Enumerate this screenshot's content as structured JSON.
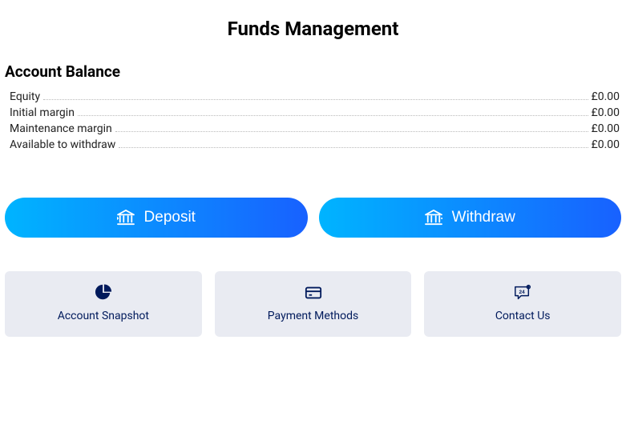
{
  "page_title": "Funds Management",
  "balance": {
    "section_title": "Account Balance",
    "rows": [
      {
        "label": "Equity",
        "value": "£0.00"
      },
      {
        "label": "Initial margin",
        "value": "£0.00"
      },
      {
        "label": "Maintenance margin",
        "value": "£0.00"
      },
      {
        "label": "Available to withdraw",
        "value": "£0.00"
      }
    ]
  },
  "actions": {
    "deposit_label": "Deposit",
    "withdraw_label": "Withdraw"
  },
  "cards": {
    "snapshot_label": "Account Snapshot",
    "payment_label": "Payment Methods",
    "contact_label": "Contact Us"
  },
  "colors": {
    "accent_gradient_start": "#00b4ff",
    "accent_gradient_end": "#1861ff",
    "card_bg": "#e9ebf2",
    "card_text": "#001a5c"
  }
}
